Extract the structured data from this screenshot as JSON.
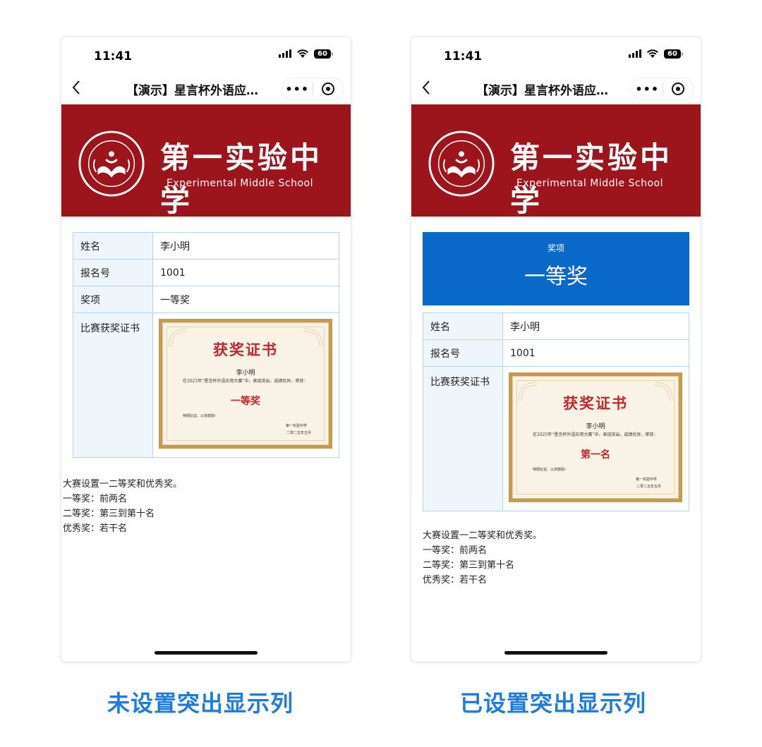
{
  "status_bar": {
    "time": "11:41",
    "battery": "60"
  },
  "navbar": {
    "title": "【演示】星言杯外语应…",
    "more": "•••"
  },
  "banner": {
    "school_name_cn": "第一实验中学",
    "school_name_en": "Experimental Middle School",
    "color": "#9c141c"
  },
  "left_screen": {
    "rows": [
      {
        "label": "姓名",
        "value": "李小明"
      },
      {
        "label": "报名号",
        "value": "1001"
      },
      {
        "label": "奖项",
        "value": "一等奖"
      }
    ],
    "certificate_label": "比赛获奖证书",
    "certificate": {
      "title": "获奖证书",
      "name": "李小明",
      "body": "在2025年“星言杯外语应用大赛”中，表现突出，成绩优异，荣获：",
      "award": "一等奖",
      "closing": "特颁此证，以资鼓励!",
      "issuer": "第一实验中学",
      "date": "二零二五年五月"
    },
    "notes": [
      "大赛设置一二等奖和优秀奖。",
      "一等奖：前两名",
      "二等奖：第三到第十名",
      "优秀奖：若干名"
    ],
    "caption": "未设置突出显示列"
  },
  "right_screen": {
    "highlight": {
      "label": "奖项",
      "value": "一等奖",
      "color": "#0a68c8"
    },
    "rows": [
      {
        "label": "姓名",
        "value": "李小明"
      },
      {
        "label": "报名号",
        "value": "1001"
      }
    ],
    "certificate_label": "比赛获奖证书",
    "certificate": {
      "title": "获奖证书",
      "name": "李小明",
      "body": "在2025年“星言杯外语应用大赛”中，表现突出，成绩优异，荣获：",
      "award": "第一名",
      "closing": "特颁此证，以资鼓励!",
      "issuer": "第一实验中学",
      "date": "二零二五年五月"
    },
    "notes": [
      "大赛设置一二等奖和优秀奖。",
      "一等奖：前两名",
      "二等奖：第三到第十名",
      "优秀奖：若干名"
    ],
    "caption": "已设置突出显示列"
  }
}
